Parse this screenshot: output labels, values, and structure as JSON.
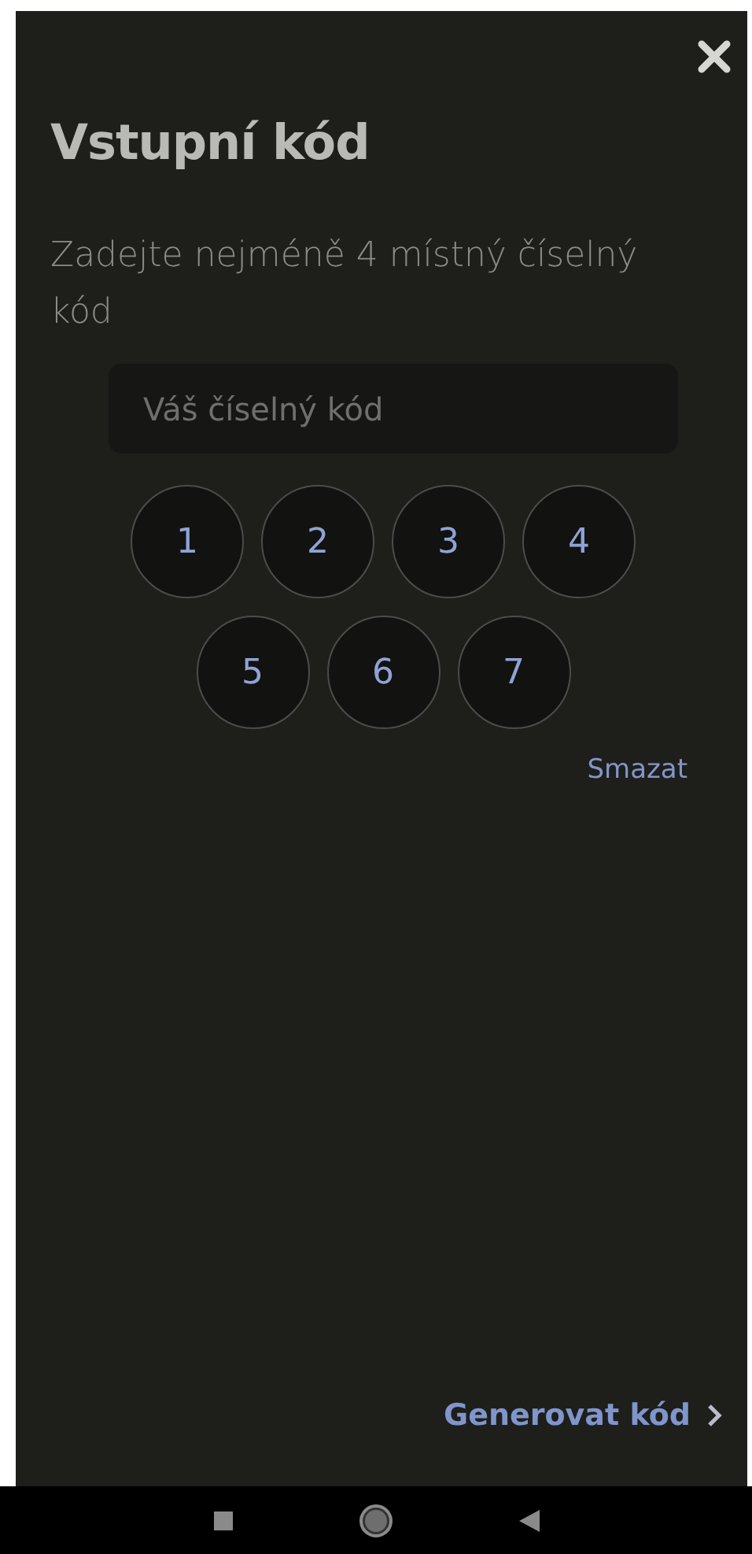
{
  "title": "Vstupní kód",
  "instructions": "Zadejte nejméně 4 místný číselný kód",
  "code_field": {
    "placeholder": "Váš číselný kód"
  },
  "keypad": [
    "1",
    "2",
    "3",
    "4",
    "5",
    "6",
    "7"
  ],
  "clear_link": "Smazat",
  "generate_link": "Generovat kód"
}
